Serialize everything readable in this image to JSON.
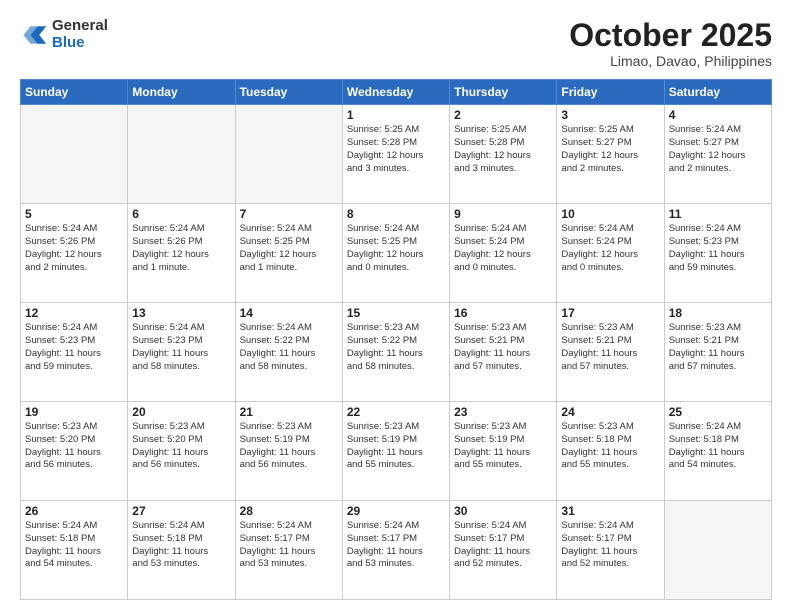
{
  "logo": {
    "general": "General",
    "blue": "Blue"
  },
  "header": {
    "title": "October 2025",
    "subtitle": "Limao, Davao, Philippines"
  },
  "weekdays": [
    "Sunday",
    "Monday",
    "Tuesday",
    "Wednesday",
    "Thursday",
    "Friday",
    "Saturday"
  ],
  "weeks": [
    [
      {
        "day": "",
        "text": ""
      },
      {
        "day": "",
        "text": ""
      },
      {
        "day": "",
        "text": ""
      },
      {
        "day": "1",
        "text": "Sunrise: 5:25 AM\nSunset: 5:28 PM\nDaylight: 12 hours\nand 3 minutes."
      },
      {
        "day": "2",
        "text": "Sunrise: 5:25 AM\nSunset: 5:28 PM\nDaylight: 12 hours\nand 3 minutes."
      },
      {
        "day": "3",
        "text": "Sunrise: 5:25 AM\nSunset: 5:27 PM\nDaylight: 12 hours\nand 2 minutes."
      },
      {
        "day": "4",
        "text": "Sunrise: 5:24 AM\nSunset: 5:27 PM\nDaylight: 12 hours\nand 2 minutes."
      }
    ],
    [
      {
        "day": "5",
        "text": "Sunrise: 5:24 AM\nSunset: 5:26 PM\nDaylight: 12 hours\nand 2 minutes."
      },
      {
        "day": "6",
        "text": "Sunrise: 5:24 AM\nSunset: 5:26 PM\nDaylight: 12 hours\nand 1 minute."
      },
      {
        "day": "7",
        "text": "Sunrise: 5:24 AM\nSunset: 5:25 PM\nDaylight: 12 hours\nand 1 minute."
      },
      {
        "day": "8",
        "text": "Sunrise: 5:24 AM\nSunset: 5:25 PM\nDaylight: 12 hours\nand 0 minutes."
      },
      {
        "day": "9",
        "text": "Sunrise: 5:24 AM\nSunset: 5:24 PM\nDaylight: 12 hours\nand 0 minutes."
      },
      {
        "day": "10",
        "text": "Sunrise: 5:24 AM\nSunset: 5:24 PM\nDaylight: 12 hours\nand 0 minutes."
      },
      {
        "day": "11",
        "text": "Sunrise: 5:24 AM\nSunset: 5:23 PM\nDaylight: 11 hours\nand 59 minutes."
      }
    ],
    [
      {
        "day": "12",
        "text": "Sunrise: 5:24 AM\nSunset: 5:23 PM\nDaylight: 11 hours\nand 59 minutes."
      },
      {
        "day": "13",
        "text": "Sunrise: 5:24 AM\nSunset: 5:23 PM\nDaylight: 11 hours\nand 58 minutes."
      },
      {
        "day": "14",
        "text": "Sunrise: 5:24 AM\nSunset: 5:22 PM\nDaylight: 11 hours\nand 58 minutes."
      },
      {
        "day": "15",
        "text": "Sunrise: 5:23 AM\nSunset: 5:22 PM\nDaylight: 11 hours\nand 58 minutes."
      },
      {
        "day": "16",
        "text": "Sunrise: 5:23 AM\nSunset: 5:21 PM\nDaylight: 11 hours\nand 57 minutes."
      },
      {
        "day": "17",
        "text": "Sunrise: 5:23 AM\nSunset: 5:21 PM\nDaylight: 11 hours\nand 57 minutes."
      },
      {
        "day": "18",
        "text": "Sunrise: 5:23 AM\nSunset: 5:21 PM\nDaylight: 11 hours\nand 57 minutes."
      }
    ],
    [
      {
        "day": "19",
        "text": "Sunrise: 5:23 AM\nSunset: 5:20 PM\nDaylight: 11 hours\nand 56 minutes."
      },
      {
        "day": "20",
        "text": "Sunrise: 5:23 AM\nSunset: 5:20 PM\nDaylight: 11 hours\nand 56 minutes."
      },
      {
        "day": "21",
        "text": "Sunrise: 5:23 AM\nSunset: 5:19 PM\nDaylight: 11 hours\nand 56 minutes."
      },
      {
        "day": "22",
        "text": "Sunrise: 5:23 AM\nSunset: 5:19 PM\nDaylight: 11 hours\nand 55 minutes."
      },
      {
        "day": "23",
        "text": "Sunrise: 5:23 AM\nSunset: 5:19 PM\nDaylight: 11 hours\nand 55 minutes."
      },
      {
        "day": "24",
        "text": "Sunrise: 5:23 AM\nSunset: 5:18 PM\nDaylight: 11 hours\nand 55 minutes."
      },
      {
        "day": "25",
        "text": "Sunrise: 5:24 AM\nSunset: 5:18 PM\nDaylight: 11 hours\nand 54 minutes."
      }
    ],
    [
      {
        "day": "26",
        "text": "Sunrise: 5:24 AM\nSunset: 5:18 PM\nDaylight: 11 hours\nand 54 minutes."
      },
      {
        "day": "27",
        "text": "Sunrise: 5:24 AM\nSunset: 5:18 PM\nDaylight: 11 hours\nand 53 minutes."
      },
      {
        "day": "28",
        "text": "Sunrise: 5:24 AM\nSunset: 5:17 PM\nDaylight: 11 hours\nand 53 minutes."
      },
      {
        "day": "29",
        "text": "Sunrise: 5:24 AM\nSunset: 5:17 PM\nDaylight: 11 hours\nand 53 minutes."
      },
      {
        "day": "30",
        "text": "Sunrise: 5:24 AM\nSunset: 5:17 PM\nDaylight: 11 hours\nand 52 minutes."
      },
      {
        "day": "31",
        "text": "Sunrise: 5:24 AM\nSunset: 5:17 PM\nDaylight: 11 hours\nand 52 minutes."
      },
      {
        "day": "",
        "text": ""
      }
    ]
  ]
}
